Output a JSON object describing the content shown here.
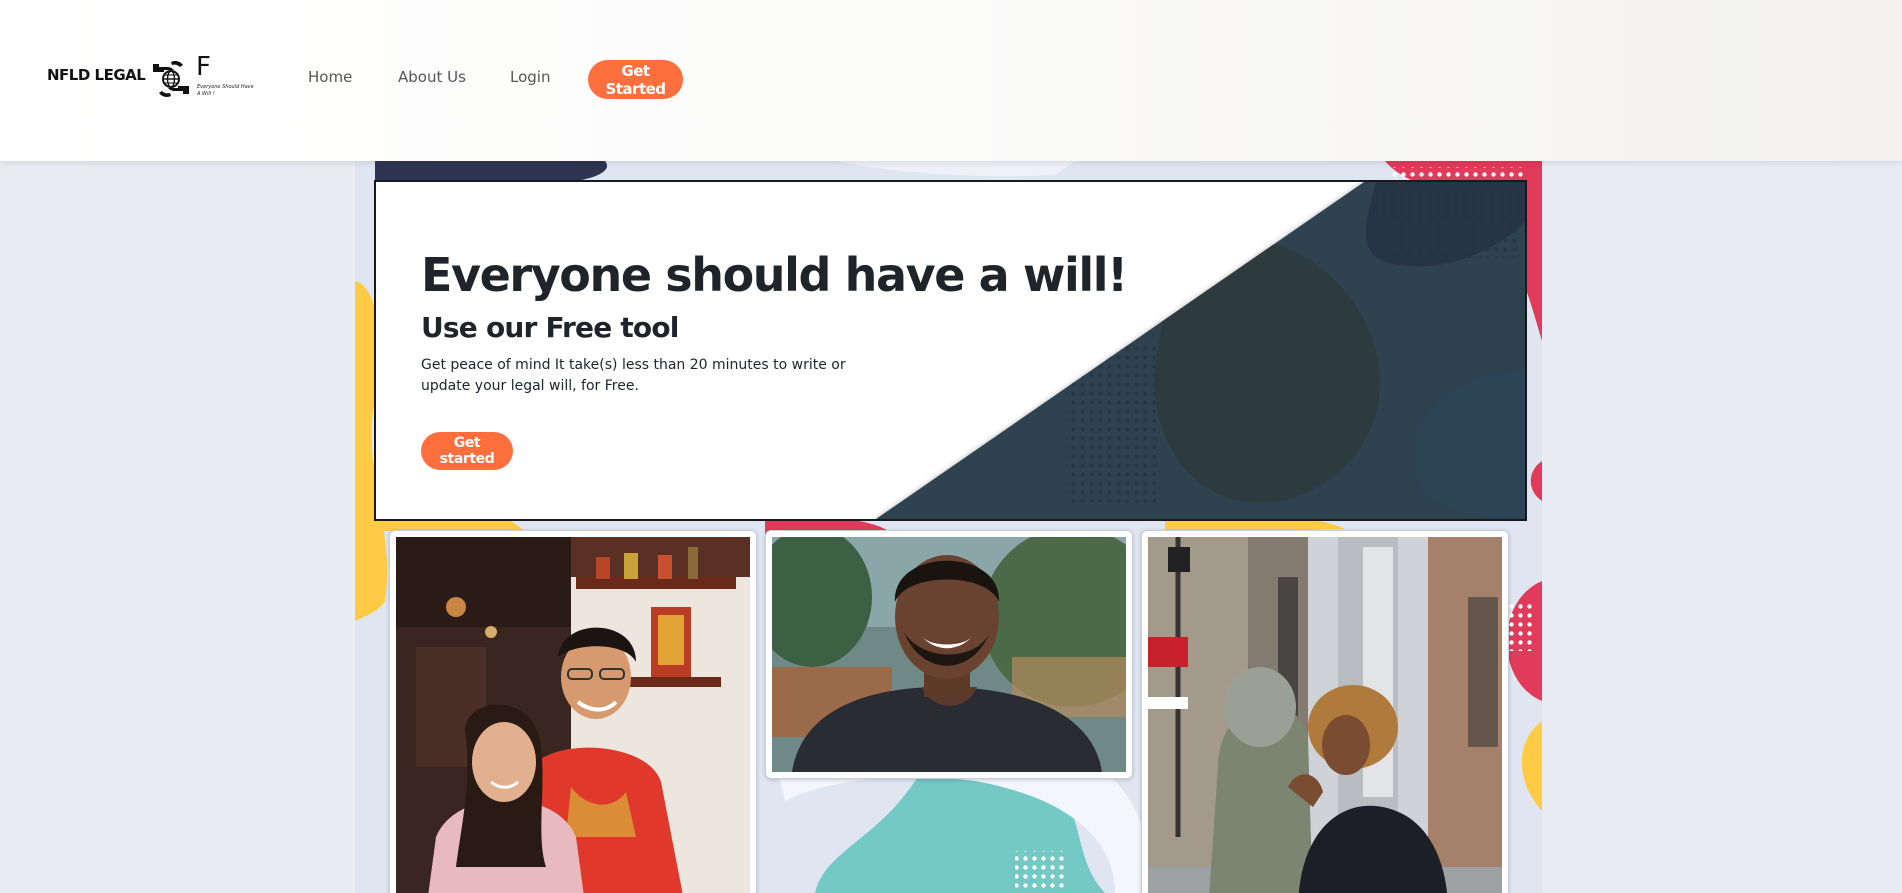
{
  "header": {
    "brand": "NFLD LEGAL",
    "logo_letter": "F",
    "logo_tagline": "Everyone Should Have A Will !",
    "nav": {
      "home": "Home",
      "about": "About Us",
      "login": "Login",
      "cta": "Get Started"
    }
  },
  "hero": {
    "title": "Everyone should have a will!",
    "subtitle": "Use our Free tool",
    "description": "Get peace of mind It take(s) less than 20 minutes to write or update your legal will, for Free.",
    "cta": "Get started"
  },
  "icons": {
    "logo": "hands-holding-globe-icon"
  },
  "colors": {
    "accent": "#ff6f3d",
    "page_background": "#e9edf3",
    "hero_dark": "#2e4350",
    "blob_navy": "#2d3552",
    "blob_pink": "#e23a5a",
    "blob_yellow": "#ffcb45",
    "blob_teal": "#74c8c5"
  }
}
